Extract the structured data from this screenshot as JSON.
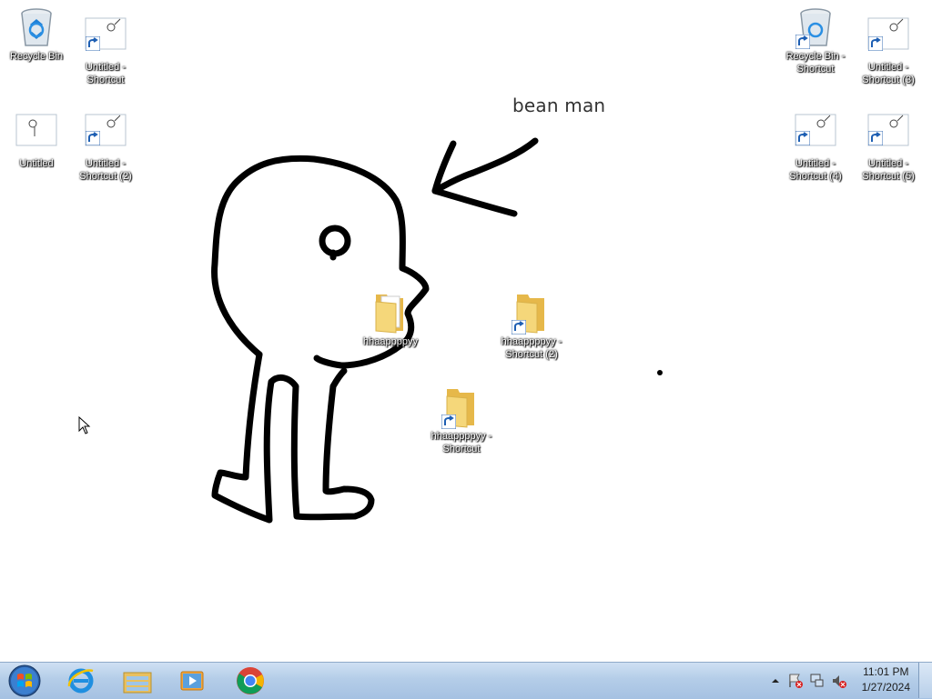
{
  "desktop": {
    "caption": "bean man",
    "icons": [
      {
        "label": "Recycle Bin",
        "kind": "recycle"
      },
      {
        "label": "Untitled - Shortcut",
        "kind": "image-shortcut"
      },
      {
        "label": "Untitled",
        "kind": "image"
      },
      {
        "label": "Untitled - Shortcut (2)",
        "kind": "image-shortcut"
      },
      {
        "label": "Recycle Bin - Shortcut",
        "kind": "recycle-shortcut"
      },
      {
        "label": "Untitled - Shortcut (3)",
        "kind": "image-shortcut"
      },
      {
        "label": "Untitled - Shortcut (4)",
        "kind": "image-shortcut"
      },
      {
        "label": "Untitled - Shortcut (5)",
        "kind": "image-shortcut"
      },
      {
        "label": "hhaappppyy",
        "kind": "folder"
      },
      {
        "label": "hhaappppyy - Shortcut (2)",
        "kind": "folder-shortcut"
      },
      {
        "label": "hhaappppyy - Shortcut",
        "kind": "folder-shortcut"
      }
    ]
  },
  "taskbar": {
    "pinned": [
      "start-orb",
      "internet-explorer-icon",
      "file-explorer-icon",
      "media-player-icon",
      "chrome-icon"
    ],
    "tray": {
      "time": "11:01 PM",
      "date": "1/27/2024"
    }
  },
  "colors": {
    "taskbar_top": "#cfe0f3",
    "taskbar_bottom": "#a5c1e2",
    "folder": "#f2c94c"
  }
}
